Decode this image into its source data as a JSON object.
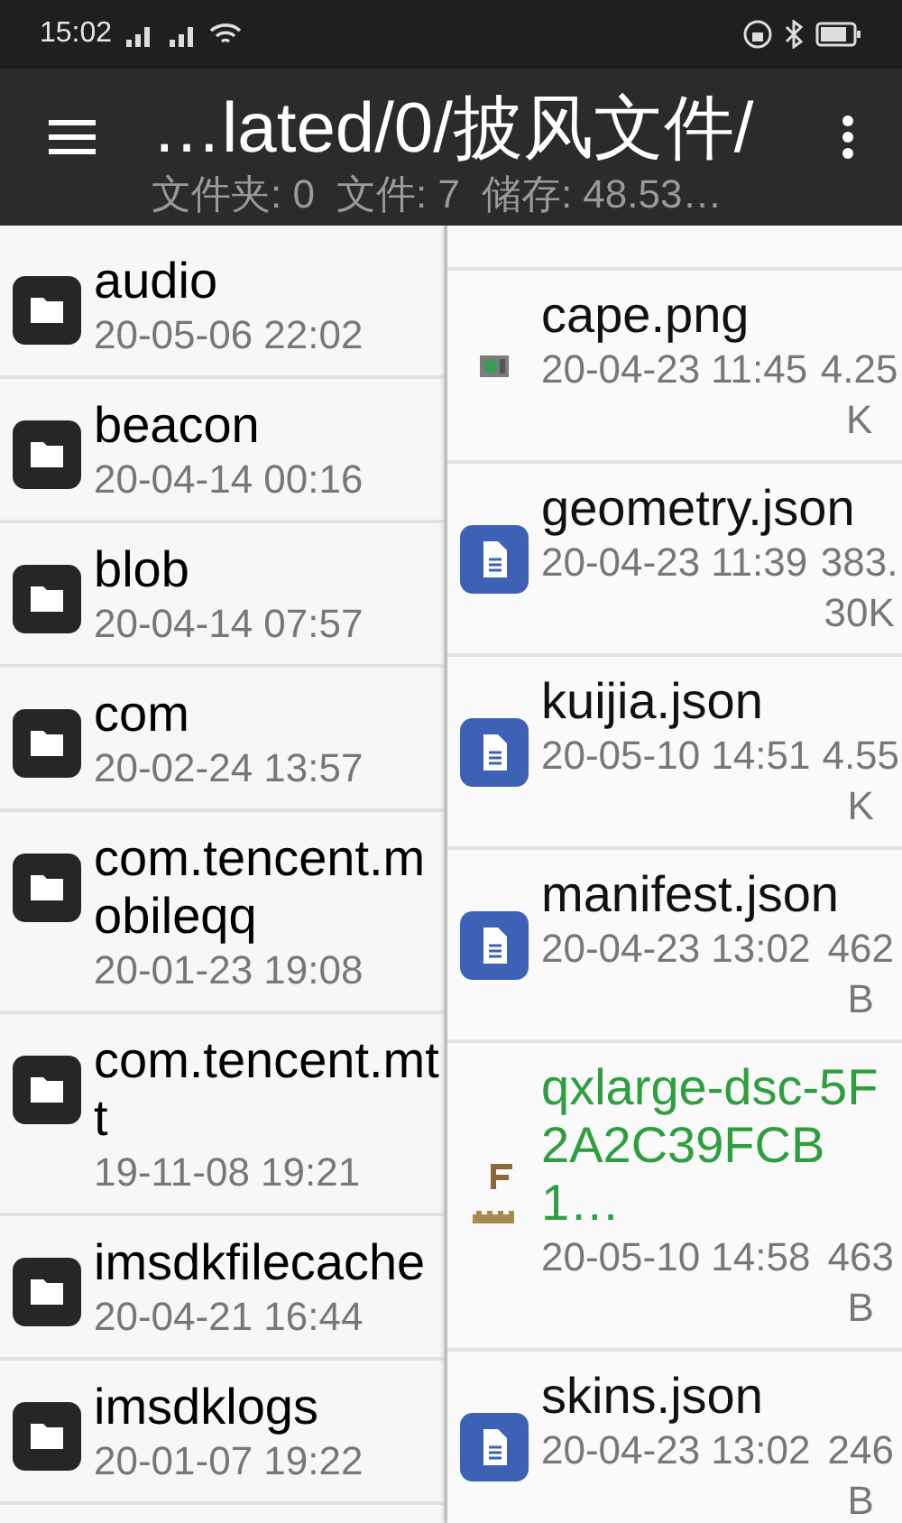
{
  "status_bar": {
    "time": "15:02"
  },
  "app_bar": {
    "title": "…lated/0/披风文件/",
    "stats": [
      "文件夹: 0",
      "文件: 7",
      "储存: 48.53…"
    ]
  },
  "folders": [
    {
      "name": "audio",
      "date": "20-05-06 22:02"
    },
    {
      "name": "beacon",
      "date": "20-04-14 00:16"
    },
    {
      "name": "blob",
      "date": "20-04-14 07:57"
    },
    {
      "name": "com",
      "date": "20-02-24 13:57"
    },
    {
      "name": "com.tencent.mobileqq",
      "date": "20-01-23 19:08"
    },
    {
      "name": "com.tencent.mtt",
      "date": "19-11-08 19:21"
    },
    {
      "name": "imsdkfilecache",
      "date": "20-04-21 16:44"
    },
    {
      "name": "imsdklogs",
      "date": "20-01-07 19:22"
    }
  ],
  "files": [
    {
      "kind": "image",
      "name": "cape.png",
      "date": "20-04-23 11:45",
      "size": "4.25K",
      "color": "#111111"
    },
    {
      "kind": "document",
      "name": "geometry.json",
      "date": "20-04-23 11:39",
      "size": "383.30K",
      "color": "#111111"
    },
    {
      "kind": "document",
      "name": "kuijia.json",
      "date": "20-05-10 14:51",
      "size": "4.55K",
      "color": "#111111"
    },
    {
      "kind": "document",
      "name": "manifest.json",
      "date": "20-04-23 13:02",
      "size": "462B",
      "color": "#111111"
    },
    {
      "kind": "texture",
      "name": "qxlarge-dsc-5F2A2C39FCB1…",
      "date": "20-05-10 14:58",
      "size": "463B",
      "color": "#2e9e3e"
    },
    {
      "kind": "document",
      "name": "skins.json",
      "date": "20-04-23 13:02",
      "size": "246B",
      "color": "#111111"
    }
  ]
}
